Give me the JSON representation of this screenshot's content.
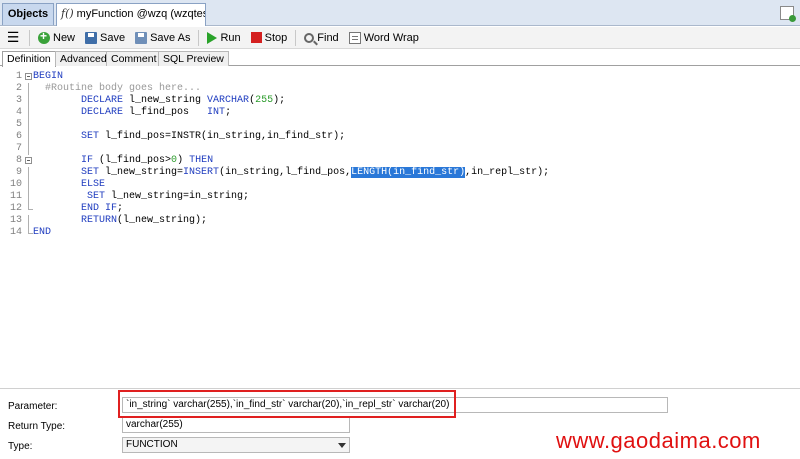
{
  "tabs": {
    "objects_label": "Objects",
    "function_tab_label": "myFunction @wzq (wzqtest)..."
  },
  "toolbar": {
    "new_label": "New",
    "save_label": "Save",
    "save_as_label": "Save As",
    "run_label": "Run",
    "stop_label": "Stop",
    "find_label": "Find",
    "word_wrap_label": "Word Wrap"
  },
  "subtabs": [
    "Definition",
    "Advanced",
    "Comment",
    "SQL Preview"
  ],
  "editor": {
    "lines": [
      {
        "n": "1",
        "fold": "box",
        "parts": [
          {
            "t": "BEGIN",
            "c": "kw"
          }
        ]
      },
      {
        "n": "2",
        "fold": "line",
        "parts": [
          {
            "t": "  #Routine body goes here...",
            "c": "cm"
          }
        ]
      },
      {
        "n": "3",
        "fold": "line",
        "parts": [
          {
            "t": "        ",
            "c": ""
          },
          {
            "t": "DECLARE",
            "c": "kw"
          },
          {
            "t": " l_new_string ",
            "c": ""
          },
          {
            "t": "VARCHAR",
            "c": "kw"
          },
          {
            "t": "(",
            "c": ""
          },
          {
            "t": "255",
            "c": "num"
          },
          {
            "t": ");",
            "c": ""
          }
        ]
      },
      {
        "n": "4",
        "fold": "line",
        "parts": [
          {
            "t": "        ",
            "c": ""
          },
          {
            "t": "DECLARE",
            "c": "kw"
          },
          {
            "t": " l_find_pos   ",
            "c": ""
          },
          {
            "t": "INT",
            "c": "kw"
          },
          {
            "t": ";",
            "c": ""
          }
        ]
      },
      {
        "n": "5",
        "fold": "line",
        "parts": [
          {
            "t": "",
            "c": ""
          }
        ]
      },
      {
        "n": "6",
        "fold": "line",
        "parts": [
          {
            "t": "        ",
            "c": ""
          },
          {
            "t": "SET",
            "c": "kw"
          },
          {
            "t": " l_find_pos=INSTR(in_string,in_find_str);",
            "c": ""
          }
        ]
      },
      {
        "n": "7",
        "fold": "line",
        "parts": [
          {
            "t": "",
            "c": ""
          }
        ]
      },
      {
        "n": "8",
        "fold": "box",
        "parts": [
          {
            "t": "        ",
            "c": ""
          },
          {
            "t": "IF",
            "c": "kw"
          },
          {
            "t": " (l_find_pos>",
            "c": ""
          },
          {
            "t": "0",
            "c": "num"
          },
          {
            "t": ") ",
            "c": ""
          },
          {
            "t": "THEN",
            "c": "kw"
          }
        ]
      },
      {
        "n": "9",
        "fold": "line",
        "parts": [
          {
            "t": "        ",
            "c": ""
          },
          {
            "t": "SET",
            "c": "kw"
          },
          {
            "t": " l_new_string=",
            "c": ""
          },
          {
            "t": "INSERT",
            "c": "kw"
          },
          {
            "t": "(in_string,l_find_pos,",
            "c": ""
          },
          {
            "t": "LENGTH(in_find_str)",
            "c": "sel"
          },
          {
            "t": ",in_repl_str);",
            "c": ""
          }
        ]
      },
      {
        "n": "10",
        "fold": "line",
        "parts": [
          {
            "t": "        ",
            "c": ""
          },
          {
            "t": "ELSE",
            "c": "kw"
          }
        ]
      },
      {
        "n": "11",
        "fold": "line",
        "parts": [
          {
            "t": "         ",
            "c": ""
          },
          {
            "t": "SET",
            "c": "kw"
          },
          {
            "t": " l_new_string=in_string;",
            "c": ""
          }
        ]
      },
      {
        "n": "12",
        "fold": "end",
        "parts": [
          {
            "t": "        ",
            "c": ""
          },
          {
            "t": "END IF",
            "c": "kw"
          },
          {
            "t": ";",
            "c": ""
          }
        ]
      },
      {
        "n": "13",
        "fold": "line",
        "parts": [
          {
            "t": "        ",
            "c": ""
          },
          {
            "t": "RETURN",
            "c": "kw"
          },
          {
            "t": "(l_new_string);",
            "c": ""
          }
        ]
      },
      {
        "n": "14",
        "fold": "end",
        "parts": [
          {
            "t": "END",
            "c": "kw"
          }
        ]
      }
    ]
  },
  "params": {
    "parameter_label": "Parameter:",
    "parameter_value": "`in_string` varchar(255),`in_find_str` varchar(20),`in_repl_str` varchar(20)",
    "return_type_label": "Return Type:",
    "return_type_value": "varchar(255)",
    "type_label": "Type:",
    "type_value": "FUNCTION"
  },
  "watermark": "www.gaodaima.com",
  "colors": {
    "keyword": "#1e3bbf",
    "comment": "#999999",
    "number": "#2b9b2b",
    "selection": "#2a78d8",
    "highlight_box": "#e02020"
  }
}
